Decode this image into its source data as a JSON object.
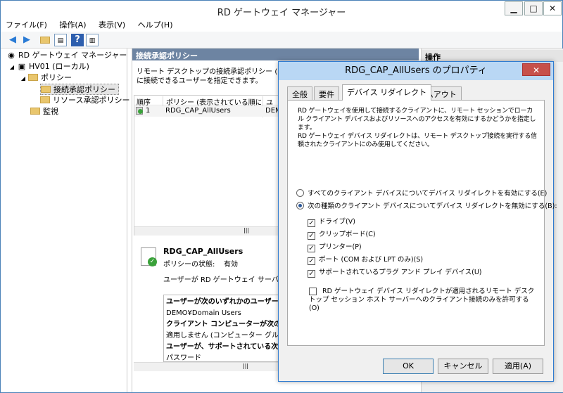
{
  "window": {
    "title": "RD ゲートウェイ マネージャー",
    "minimize": "▁",
    "maximize": "□",
    "close": "✕"
  },
  "menu": [
    "ファイル(F)",
    "操作(A)",
    "表示(V)",
    "ヘルプ(H)"
  ],
  "tree": {
    "root": "RD ゲートウェイ マネージャー",
    "server": "HV01 (ローカル)",
    "policies": "ポリシー",
    "cap": "接続承認ポリシー",
    "rap": "リソース承認ポリシー",
    "monitor": "監視"
  },
  "center": {
    "header": "接続承認ポリシー",
    "description": "リモート デスクトップの接続承認ポリシー (RD CAP)\nに接続できるユーザーを指定できます。",
    "columns": [
      "順序",
      "ポリシー (表示されている順に...",
      "ユー"
    ],
    "rows": [
      {
        "order": "1",
        "policy": "RDG_CAP_AllUsers",
        "user": "DEMO"
      }
    ],
    "detail": {
      "name": "RDG_CAP_AllUsers",
      "status_label": "ポリシーの状態:",
      "status_value": "有効",
      "summary": "ユーザーが RD ゲートウェイ サーバーにアク",
      "lines": [
        {
          "text": "ユーザーが次のいずれかのユーザー グル",
          "bold": true
        },
        {
          "text": "DEMO¥Domain Users",
          "bold": false
        },
        {
          "text": "クライアント コンピューターが次のいずれ",
          "bold": true
        },
        {
          "text": "適用しません (コンピューター グループが指",
          "bold": false
        },
        {
          "text": "ユーザーが、サポートされている次の Wi",
          "bold": true
        },
        {
          "text": "パスワード",
          "bold": false
        }
      ]
    }
  },
  "actions": {
    "header": "操作"
  },
  "dialog": {
    "title": "RDG_CAP_AllUsers のプロパティ",
    "close": "✕",
    "tabs": [
      "全般",
      "要件",
      "デバイス リダイレクト",
      "タイムアウト"
    ],
    "active_tab": "デバイス リダイレクト",
    "description": "RD ゲートウェイを使用して接続するクライアントに、リモート セッションでローカル クライアント デバイスおよびリソースへのアクセスを有効にするかどうかを指定します。\nRD ゲートウェイ デバイス リダイレクトは、リモート デスクトップ接続を実行する信頼されたクライアントにのみ使用してください。",
    "radio_all": "すべてのクライアント デバイスについてデバイス リダイレクトを有効にする(E)",
    "radio_disable": "次の種類のクライアント デバイスについてデバイス リダイレクトを無効にする(B):",
    "selected_radio": "radio_disable",
    "checks": [
      {
        "label": "ドライブ(V)",
        "checked": true
      },
      {
        "label": "クリップボード(C)",
        "checked": true
      },
      {
        "label": "プリンター(P)",
        "checked": true
      },
      {
        "label": "ポート (COM および LPT のみ)(S)",
        "checked": true
      },
      {
        "label": "サポートされているプラグ アンド プレイ デバイス(U)",
        "checked": true
      }
    ],
    "allow_only": "RD ゲートウェイ デバイス リダイレクトが適用されるリモート デスクトップ セッション ホスト サーバーへのクライアント接続のみを許可する(O)",
    "allow_only_checked": false,
    "ok": "OK",
    "cancel": "キャンセル",
    "apply": "適用(A)"
  }
}
